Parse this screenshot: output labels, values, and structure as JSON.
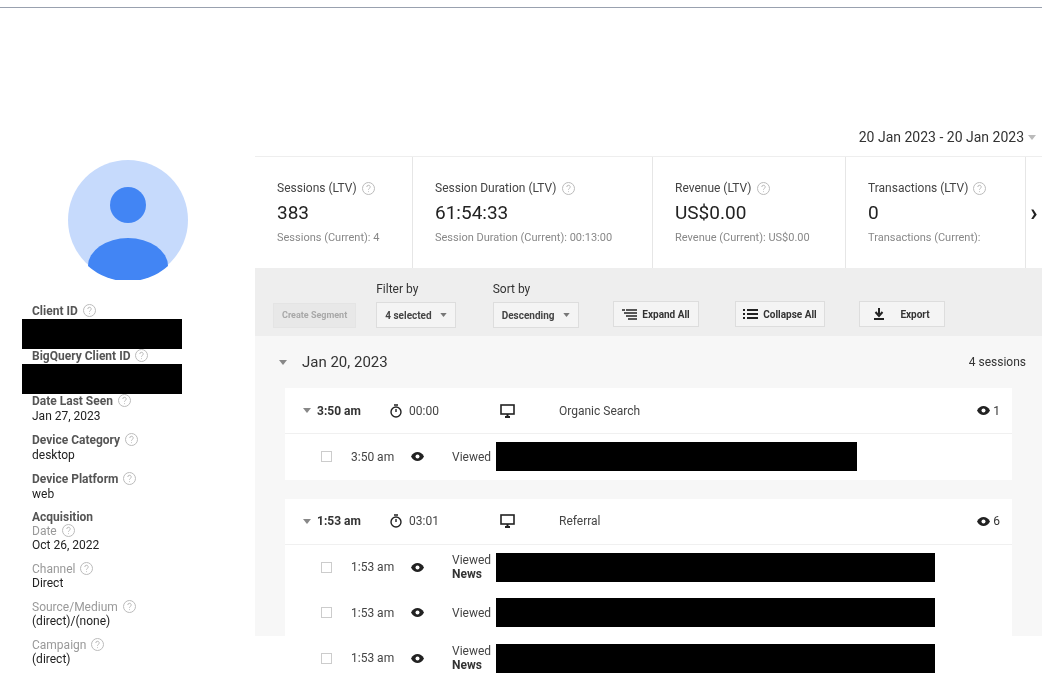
{
  "date_range": {
    "label": "20 Jan 2023 - 20 Jan 2023"
  },
  "profile": {
    "fields": [
      {
        "kind": "bold",
        "label": "Client ID",
        "redacted": true
      },
      {
        "kind": "bold",
        "label": "BigQuery Client ID",
        "redacted": true
      },
      {
        "kind": "bold",
        "label": "Date Last Seen",
        "value": "Jan 27, 2023"
      },
      {
        "kind": "bold",
        "label": "Device Category",
        "value": "desktop"
      },
      {
        "kind": "bold",
        "label": "Device Platform",
        "value": "web"
      },
      {
        "kind": "heading",
        "label": "Acquisition"
      },
      {
        "kind": "light",
        "label": "Date",
        "value": "Oct 26, 2022"
      },
      {
        "kind": "light",
        "label": "Channel",
        "value": "Direct"
      },
      {
        "kind": "light",
        "label": "Source/Medium",
        "value": "(direct)/(none)"
      },
      {
        "kind": "light",
        "label": "Campaign",
        "value": "(direct)"
      }
    ]
  },
  "metrics": [
    {
      "label": "Sessions (LTV)",
      "value": "383",
      "sub": "Sessions (Current): 4"
    },
    {
      "label": "Session Duration (LTV)",
      "value": "61:54:33",
      "sub": "Session Duration (Current): 00:13:00"
    },
    {
      "label": "Revenue (LTV)",
      "value": "US$0.00",
      "sub": "Revenue (Current): US$0.00"
    },
    {
      "label": "Transactions (LTV)",
      "value": "0",
      "sub": "Transactions (Current): "
    }
  ],
  "metrics_next": "›",
  "toolbar": {
    "create_segment": {
      "label": "Create Segment",
      "disabled": true
    },
    "filter": {
      "label": "Filter by",
      "value": "4 selected"
    },
    "sort": {
      "label": "Sort by",
      "value": "Descending"
    },
    "buttons": [
      {
        "kind": "expand",
        "label": "Expand All"
      },
      {
        "kind": "collapse",
        "label": "Collapse All"
      },
      {
        "kind": "export",
        "label": "Export"
      }
    ]
  },
  "day": {
    "date": "Jan 20, 2023",
    "count": "4 sessions",
    "expanded": true,
    "sessions": [
      {
        "time": "3:50 am",
        "duration": "00:00",
        "channel": "Organic Search",
        "views": "1",
        "expanded": true,
        "hits": [
          {
            "time": "3:50 am",
            "text": "Viewed",
            "checked": false
          }
        ]
      },
      {
        "time": "1:53 am",
        "duration": "03:01",
        "channel": "Referral",
        "views": "6",
        "expanded": true,
        "hits": [
          {
            "time": "1:53 am",
            "text": "Viewed",
            "sub": "News",
            "checked": false
          },
          {
            "time": "1:53 am",
            "text": "Viewed",
            "checked": false
          },
          {
            "time": "1:53 am",
            "text": "Viewed",
            "sub": "News",
            "checked": false
          }
        ]
      }
    ]
  }
}
